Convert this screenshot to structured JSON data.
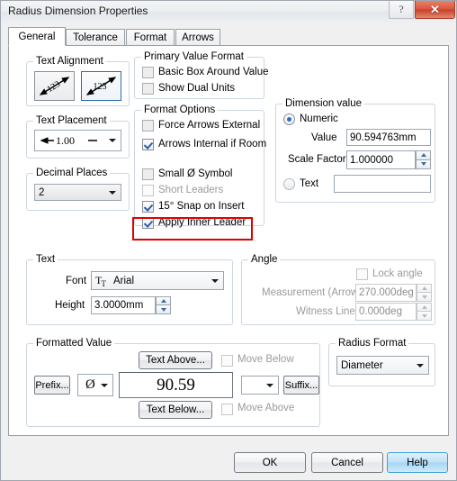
{
  "window": {
    "title": "Radius Dimension Properties",
    "help_button": "?",
    "close_button": "✕"
  },
  "tabs": [
    {
      "label": "General",
      "active": true
    },
    {
      "label": "Tolerance",
      "active": false
    },
    {
      "label": "Format",
      "active": false
    },
    {
      "label": "Arrows",
      "active": false
    }
  ],
  "text_alignment": {
    "legend": "Text Alignment",
    "option_aligned": "123",
    "option_horizontal": "123",
    "selected": "horizontal"
  },
  "text_placement": {
    "legend": "Text Placement",
    "value": "1.00"
  },
  "decimal_places": {
    "legend": "Decimal Places",
    "value": "2"
  },
  "primary_value_format": {
    "legend": "Primary Value Format",
    "items": [
      {
        "label": "Basic Box Around Value",
        "checked": false,
        "enabled": true
      },
      {
        "label": "Show Dual Units",
        "checked": false,
        "enabled": true
      }
    ]
  },
  "format_options": {
    "legend": "Format Options",
    "items": [
      {
        "label": "Force Arrows External",
        "checked": false,
        "enabled": true
      },
      {
        "label": "Arrows Internal if Room",
        "checked": true,
        "enabled": true
      },
      {
        "label": "Small Ø Symbol",
        "checked": false,
        "enabled": true
      },
      {
        "label": "Short Leaders",
        "checked": false,
        "enabled": false
      },
      {
        "label": "15° Snap on Insert",
        "checked": true,
        "enabled": true
      },
      {
        "label": "Apply Inner Leader",
        "checked": true,
        "enabled": true,
        "highlighted": true
      }
    ]
  },
  "dimension_value": {
    "legend": "Dimension value",
    "numeric_label": "Numeric",
    "numeric_selected": true,
    "value_label": "Value",
    "value": "90.594763mm",
    "scale_factor_label": "Scale Factor",
    "scale_factor": "1.000000",
    "text_label": "Text",
    "text_selected": false,
    "text_value": ""
  },
  "text_group": {
    "legend": "Text",
    "font_label": "Font",
    "font_value": "Arial",
    "font_icon": "font-glyph-icon",
    "height_label": "Height",
    "height_value": "3.0000mm"
  },
  "angle_group": {
    "legend": "Angle",
    "lock_angle_label": "Lock angle",
    "lock_angle_checked": false,
    "measurement_label": "Measurement (Arrow)",
    "measurement_value": "270.000deg",
    "witness_label": "Witness Line",
    "witness_value": "0.000deg"
  },
  "formatted_value": {
    "legend": "Formatted Value",
    "text_above_button": "Text Above...",
    "move_below_label": "Move Below",
    "move_below_checked": false,
    "prefix_button": "Prefix...",
    "symbol": "Ø",
    "value": "90.59",
    "suffix_select": "",
    "suffix_button": "Suffix...",
    "text_below_button": "Text Below...",
    "move_above_label": "Move Above",
    "move_above_checked": false
  },
  "radius_format": {
    "legend": "Radius Format",
    "value": "Diameter"
  },
  "footer": {
    "ok": "OK",
    "cancel": "Cancel",
    "help": "Help"
  },
  "colors": {
    "close_red": "#d9563c",
    "highlight_red": "#e00000",
    "help_blue": "#a6d6f4",
    "group_border": "#cdd6e0"
  }
}
